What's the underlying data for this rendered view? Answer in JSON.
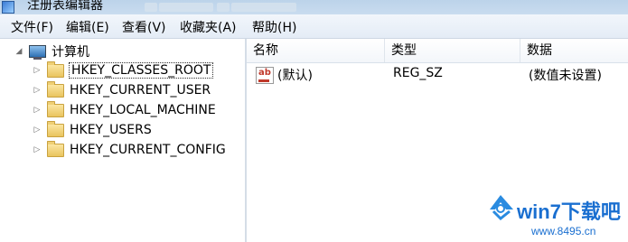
{
  "window": {
    "title": "注册表编辑器"
  },
  "menu": [
    {
      "label": "文件(F)"
    },
    {
      "label": "编辑(E)"
    },
    {
      "label": "查看(V)"
    },
    {
      "label": "收藏夹(A)"
    },
    {
      "label": "帮助(H)"
    }
  ],
  "tree": {
    "root": {
      "label": "计算机",
      "icon": "computer-icon"
    },
    "keys": [
      {
        "label": "HKEY_CLASSES_ROOT",
        "selected": true
      },
      {
        "label": "HKEY_CURRENT_USER"
      },
      {
        "label": "HKEY_LOCAL_MACHINE"
      },
      {
        "label": "HKEY_USERS"
      },
      {
        "label": "HKEY_CURRENT_CONFIG"
      }
    ]
  },
  "list": {
    "columns": [
      "名称",
      "类型",
      "数据"
    ],
    "rows": [
      {
        "name": "(默认)",
        "type": "REG_SZ",
        "data": "(数值未设置)",
        "icon": "string-value-icon"
      }
    ]
  },
  "watermark": {
    "brand": "win7下载吧",
    "url": "www.8495.cn"
  }
}
